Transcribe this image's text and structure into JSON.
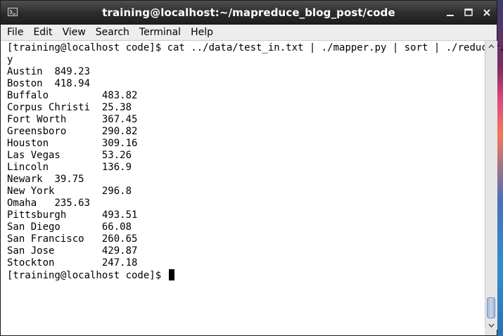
{
  "window": {
    "title": "training@localhost:~/mapreduce_blog_post/code"
  },
  "menu": [
    "File",
    "Edit",
    "View",
    "Search",
    "Terminal",
    "Help"
  ],
  "terminal": {
    "command_prompt": "[training@localhost code]$ ",
    "command": "cat ../data/test_in.txt | ./mapper.py | sort | ./reducer.p",
    "command_wrap": "y",
    "output_rows": [
      {
        "city": "Austin",
        "sep": "  ",
        "value": "849.23"
      },
      {
        "city": "Boston",
        "sep": "  ",
        "value": "418.94"
      },
      {
        "city": "Buffalo",
        "sep": "         ",
        "value": "483.82"
      },
      {
        "city": "Corpus Christi",
        "sep": "  ",
        "value": "25.38"
      },
      {
        "city": "Fort Worth",
        "sep": "      ",
        "value": "367.45"
      },
      {
        "city": "Greensboro",
        "sep": "      ",
        "value": "290.82"
      },
      {
        "city": "Houston",
        "sep": "         ",
        "value": "309.16"
      },
      {
        "city": "Las Vegas",
        "sep": "       ",
        "value": "53.26"
      },
      {
        "city": "Lincoln",
        "sep": "         ",
        "value": "136.9"
      },
      {
        "city": "Newark",
        "sep": "  ",
        "value": "39.75"
      },
      {
        "city": "New York",
        "sep": "        ",
        "value": "296.8"
      },
      {
        "city": "Omaha",
        "sep": "   ",
        "value": "235.63"
      },
      {
        "city": "Pittsburgh",
        "sep": "      ",
        "value": "493.51"
      },
      {
        "city": "San Diego",
        "sep": "       ",
        "value": "66.08"
      },
      {
        "city": "San Francisco",
        "sep": "   ",
        "value": "260.65"
      },
      {
        "city": "San Jose",
        "sep": "        ",
        "value": "429.87"
      },
      {
        "city": "Stockton",
        "sep": "        ",
        "value": "247.18"
      }
    ],
    "final_prompt": "[training@localhost code]$ "
  },
  "icons": {
    "window": "terminal-icon",
    "minimize": "minimize-icon",
    "maximize": "maximize-icon",
    "close": "close-icon"
  }
}
